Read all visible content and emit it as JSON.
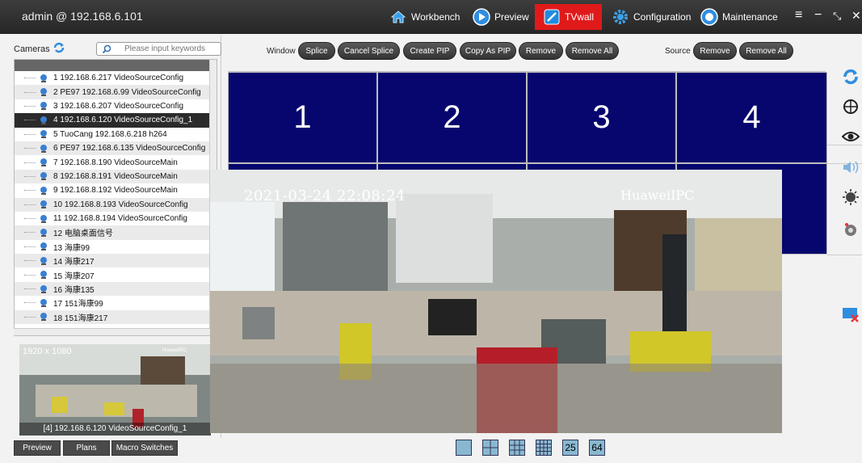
{
  "titlebar": {
    "title": "admin @ 192.168.6.101",
    "nav": [
      {
        "label": "Workbench"
      },
      {
        "label": "Preview"
      },
      {
        "label": "TVwall"
      },
      {
        "label": "Configuration"
      },
      {
        "label": "Maintenance"
      }
    ],
    "active": "TVwall"
  },
  "cameras": {
    "label": "Cameras",
    "search_placeholder": "Please input keywords",
    "items": [
      "1 192.168.6.217 VideoSourceConfig",
      "2 PE97 192.168.6.99 VideoSourceConfig",
      "3 192.168.6.207 VideoSourceConfig",
      "4 192.168.6.120 VideoSourceConfig_1",
      "5 TuoCang 192.168.6.218 h264",
      "6 PE97 192.168.6.135 VideoSourceConfig",
      "7 192.168.8.190 VideoSourceMain",
      "8 192.168.8.191 VideoSourceMain",
      "9 192.168.8.192 VideoSourceMain",
      "10 192.168.8.193 VideoSourceConfig",
      "11 192.168.8.194 VideoSourceConfig",
      "12 电脑桌面信号",
      "13 海康99",
      "14 海康217",
      "15 海康207",
      "16 海康135",
      "17 151海康99",
      "18 151海康217"
    ],
    "selected_index": 3
  },
  "preview": {
    "resolution": "1920 x 1080",
    "camera_name": "HuaweiIPC",
    "caption": "[4]  192.168.6.120 VideoSourceConfig_1"
  },
  "bottom_tabs": [
    "Preview",
    "Plans",
    "Macro Switches"
  ],
  "toolbar": {
    "window_label": "Window",
    "window_buttons": [
      "Splice",
      "Cancel Splice",
      "Create PIP",
      "Copy As PIP",
      "Remove",
      "Remove All"
    ],
    "source_label": "Source",
    "source_buttons": [
      "Remove",
      "Remove All"
    ]
  },
  "wall": {
    "cells": [
      "1",
      "2",
      "3",
      "4"
    ]
  },
  "video": {
    "timestamp": "2021-03-24 22:08:24",
    "camera": "HuaweiIPC"
  },
  "layouts": [
    "",
    "",
    "",
    "",
    "25",
    "64"
  ],
  "colors": {
    "wall_cell": "#06066e",
    "active_tab": "#e01a1a",
    "titlebar": "#2c2c2c"
  }
}
